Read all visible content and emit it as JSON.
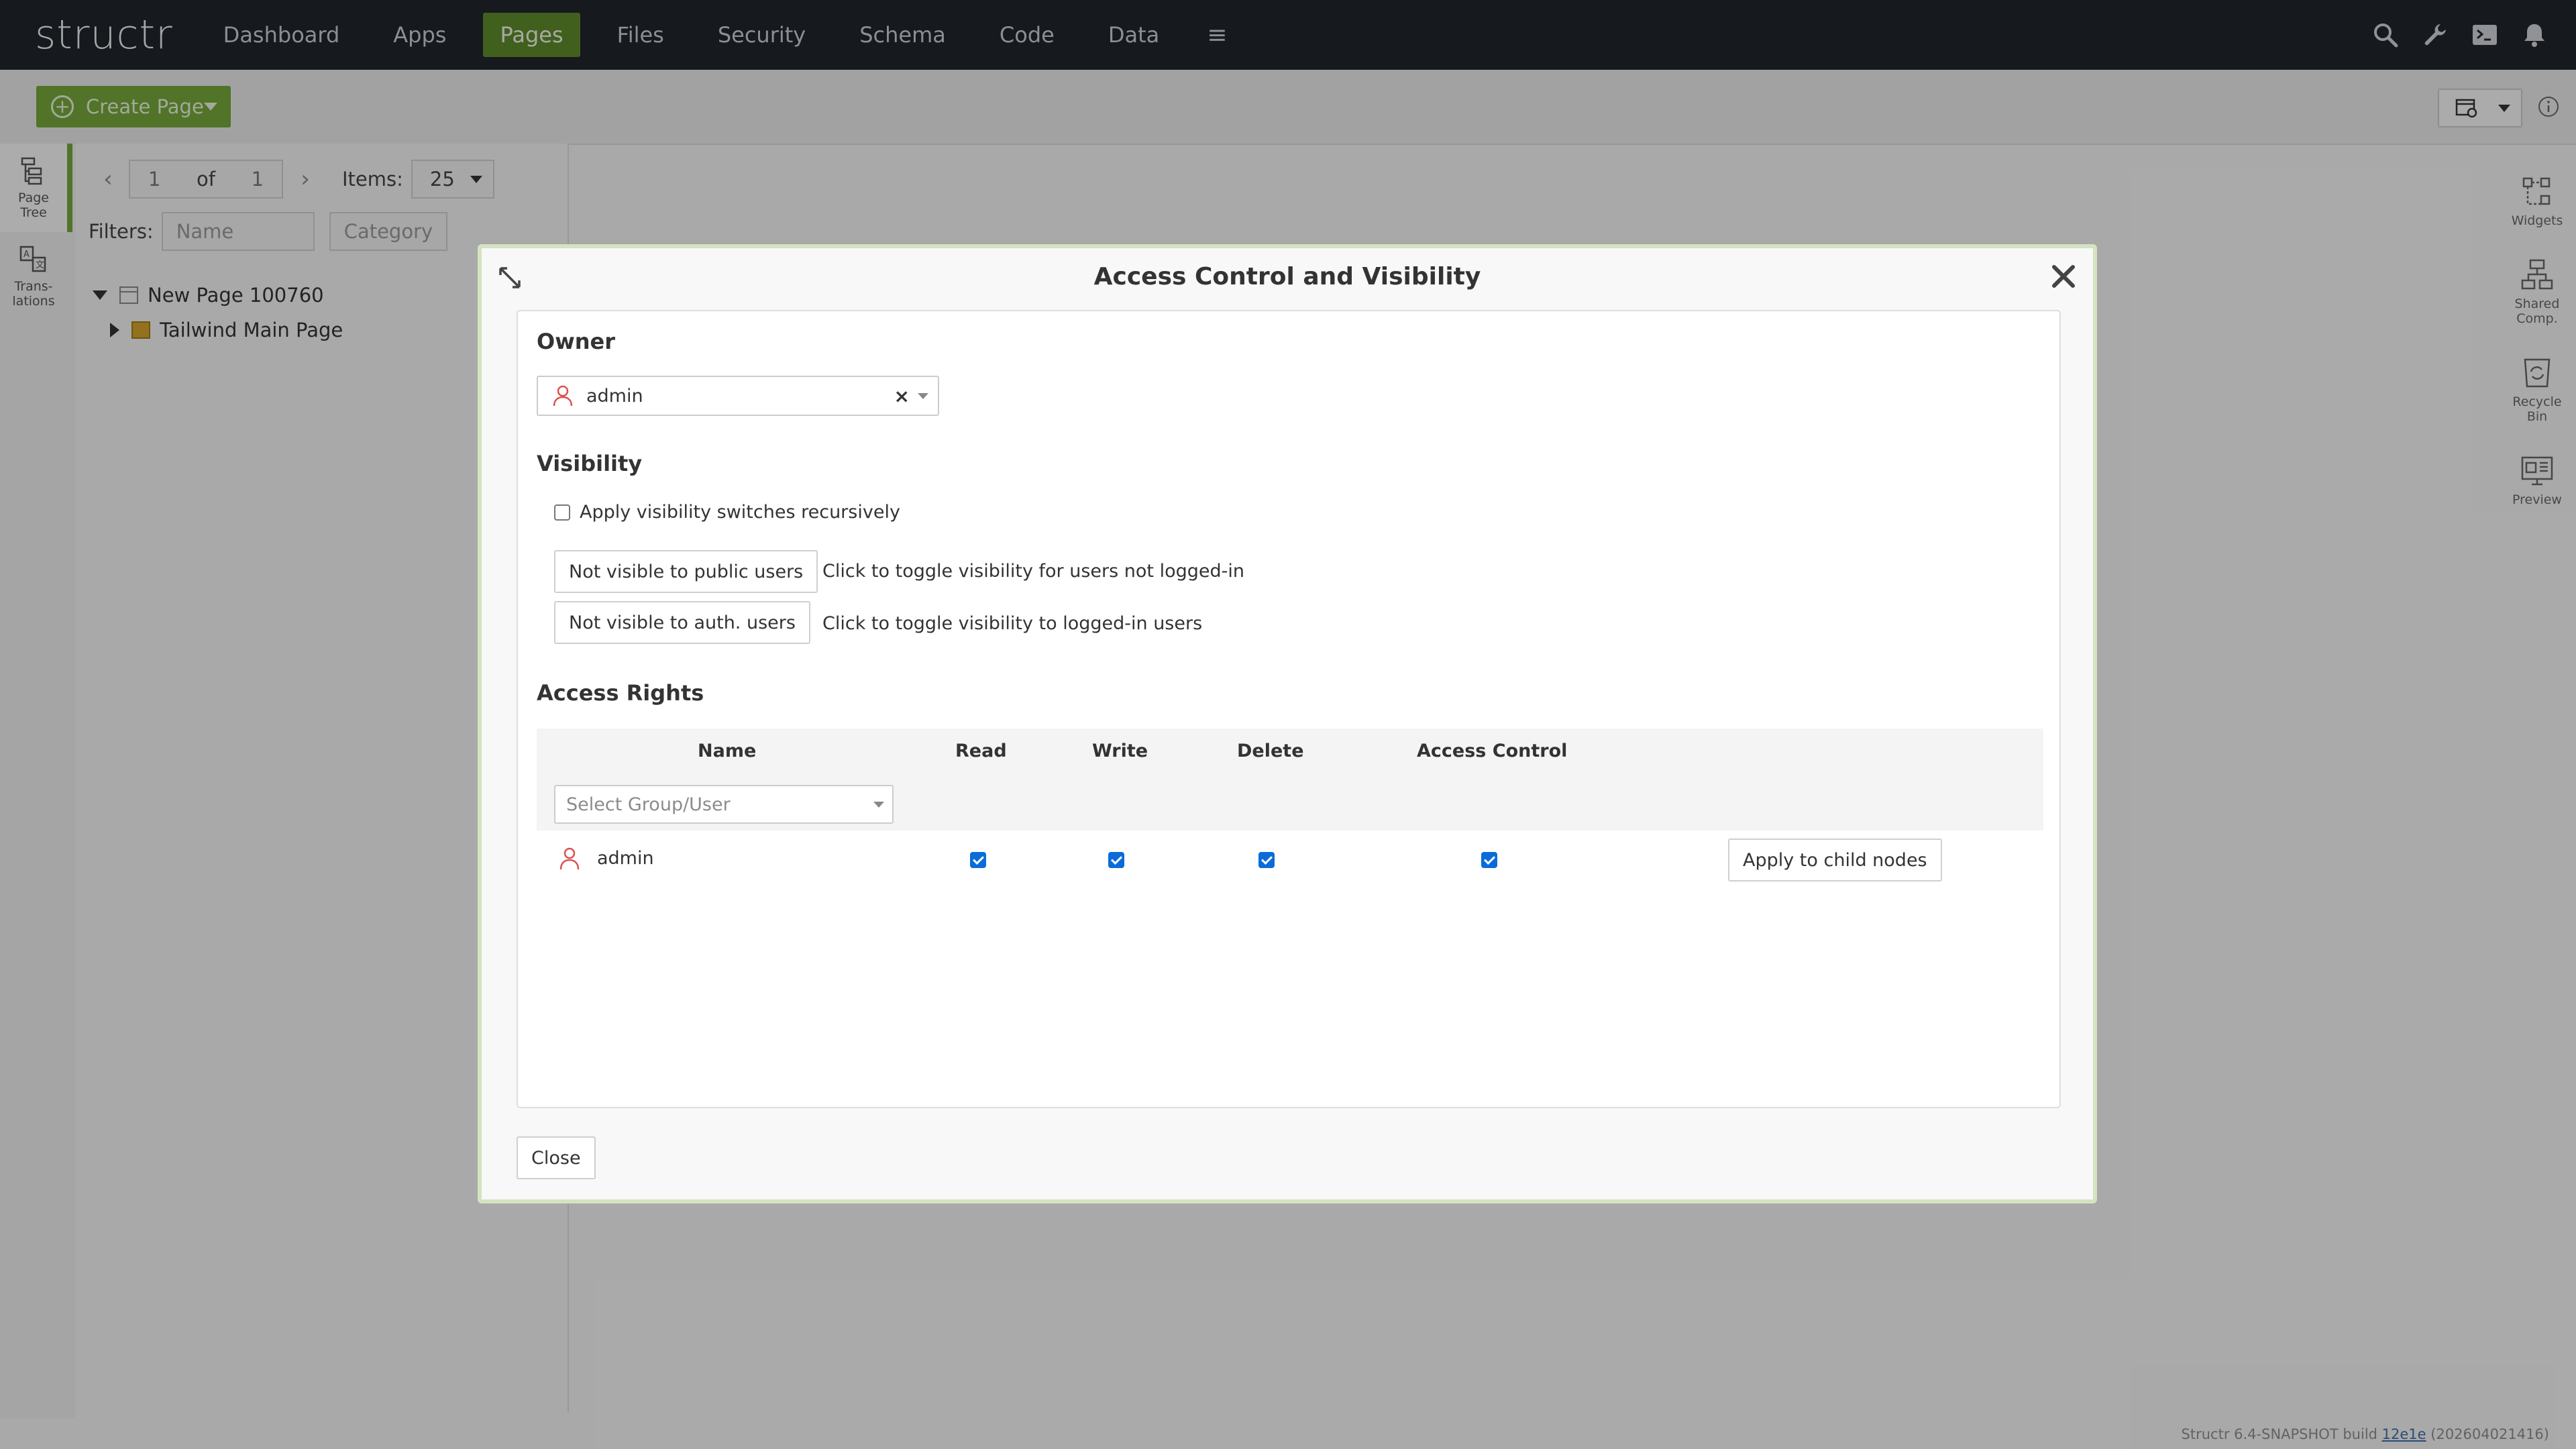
{
  "app": {
    "logo": "structr"
  },
  "nav": {
    "items": [
      {
        "label": "Dashboard"
      },
      {
        "label": "Apps"
      },
      {
        "label": "Pages",
        "active": true
      },
      {
        "label": "Files"
      },
      {
        "label": "Security"
      },
      {
        "label": "Schema"
      },
      {
        "label": "Code"
      },
      {
        "label": "Data"
      }
    ],
    "menu_icon": "hamburger-icon",
    "right_icons": [
      "search-icon",
      "wrench-icon",
      "terminal-icon",
      "bell-icon"
    ]
  },
  "toolbar": {
    "create_page_label": "Create Page"
  },
  "left_tabs": [
    {
      "label_line1": "Page",
      "label_line2": "Tree",
      "icon": "page-tree-icon",
      "active": true
    },
    {
      "label_line1": "Trans-",
      "label_line2": "lations",
      "icon": "translations-icon"
    }
  ],
  "pager": {
    "current": "1",
    "of_label": "of",
    "total": "1",
    "items_label": "Items:",
    "items_value": "25"
  },
  "filters": {
    "label": "Filters:",
    "name_placeholder": "Name",
    "category_placeholder": "Category"
  },
  "tree": [
    {
      "label": "New Page 100760",
      "expanded": true
    },
    {
      "label": "Tailwind Main Page",
      "expanded": false
    }
  ],
  "right_tabs": [
    {
      "label_line1": "Widgets",
      "label_line2": "",
      "icon": "widgets-icon"
    },
    {
      "label_line1": "Shared",
      "label_line2": "Comp.",
      "icon": "shared-components-icon"
    },
    {
      "label_line1": "Recycle",
      "label_line2": "Bin",
      "icon": "recycle-bin-icon"
    },
    {
      "label_line1": "Preview",
      "label_line2": "",
      "icon": "preview-icon"
    }
  ],
  "footer": {
    "prefix": "Structr 6.4-SNAPSHOT build ",
    "build": "12e1e",
    "suffix": " (202604021416)"
  },
  "dialog": {
    "title": "Access Control and Visibility",
    "owner": {
      "heading": "Owner",
      "value": "admin"
    },
    "visibility": {
      "heading": "Visibility",
      "recursive_label": "Apply visibility switches recursively",
      "recursive_checked": false,
      "public_button": "Not visible to public users",
      "public_help": "Click to toggle visibility for users not logged-in",
      "auth_button": "Not visible to auth. users",
      "auth_help": "Click to toggle visibility to logged-in users"
    },
    "access_rights": {
      "heading": "Access Rights",
      "columns": [
        "Name",
        "Read",
        "Write",
        "Delete",
        "Access Control"
      ],
      "select_placeholder": "Select Group/User",
      "rows": [
        {
          "name": "admin",
          "read": true,
          "write": true,
          "delete": true,
          "access_control": true
        }
      ],
      "apply_button": "Apply to child nodes"
    },
    "close_button": "Close"
  },
  "colors": {
    "accent": "#74a63c",
    "nav_bg": "#20242b",
    "user_icon": "#d9534f",
    "checkbox": "#0b6cd9"
  }
}
